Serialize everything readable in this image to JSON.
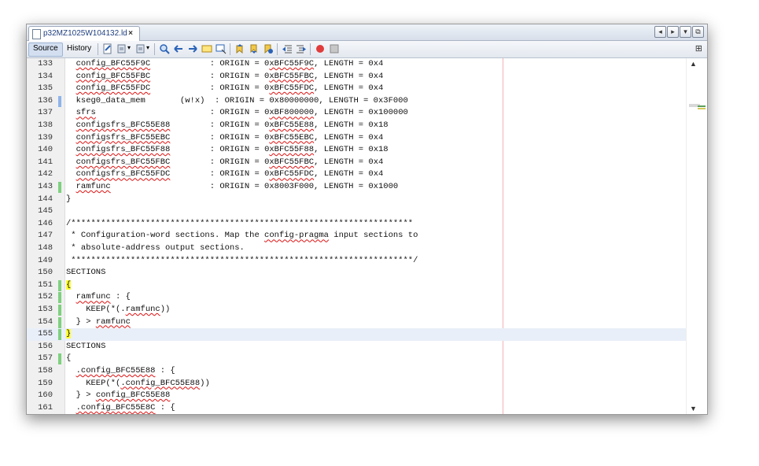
{
  "tab": {
    "title": "p32MZ1025W104132.ld",
    "close": "×"
  },
  "window_controls": [
    "◂",
    "▸",
    "▾",
    "⧉"
  ],
  "toolbar": {
    "source_label": "Source",
    "history_label": "History",
    "icons": [
      "last-edit-icon",
      "back-icon",
      "forward-icon",
      "find-selection-icon",
      "find-previous-icon",
      "find-next-icon",
      "toggle-highlight-icon",
      "toggle-rect-select-icon",
      "previous-bookmark-icon",
      "next-bookmark-icon",
      "toggle-bookmark-icon",
      "shift-left-icon",
      "shift-right-icon",
      "record-macro-icon",
      "stop-macro-icon"
    ],
    "right_icon": "⊞"
  },
  "editor": {
    "lines": [
      {
        "num": "133",
        "mark": "",
        "code": "  config_BFC55F9C            : ORIGIN = 0xBFC55F9C, LENGTH = 0x4"
      },
      {
        "num": "134",
        "mark": "",
        "code": "  config_BFC55FBC            : ORIGIN = 0xBFC55FBC, LENGTH = 0x4"
      },
      {
        "num": "135",
        "mark": "",
        "code": "  config_BFC55FDC            : ORIGIN = 0xBFC55FDC, LENGTH = 0x4"
      },
      {
        "num": "136",
        "mark": "blue",
        "code": "  kseg0_data_mem       (w!x)  : ORIGIN = 0x80000000, LENGTH = 0x3F000"
      },
      {
        "num": "137",
        "mark": "",
        "code": "  sfrs                       : ORIGIN = 0xBF800000, LENGTH = 0x100000"
      },
      {
        "num": "138",
        "mark": "",
        "code": "  configsfrs_BFC55E88        : ORIGIN = 0xBFC55E88, LENGTH = 0x18"
      },
      {
        "num": "139",
        "mark": "",
        "code": "  configsfrs_BFC55EBC        : ORIGIN = 0xBFC55EBC, LENGTH = 0x4"
      },
      {
        "num": "140",
        "mark": "",
        "code": "  configsfrs_BFC55F88        : ORIGIN = 0xBFC55F88, LENGTH = 0x18"
      },
      {
        "num": "141",
        "mark": "",
        "code": "  configsfrs_BFC55FBC        : ORIGIN = 0xBFC55FBC, LENGTH = 0x4"
      },
      {
        "num": "142",
        "mark": "",
        "code": "  configsfrs_BFC55FDC        : ORIGIN = 0xBFC55FDC, LENGTH = 0x4"
      },
      {
        "num": "143",
        "mark": "green",
        "code": "  ramfunc                    : ORIGIN = 0x8003F000, LENGTH = 0x1000"
      },
      {
        "num": "144",
        "mark": "",
        "code": "}"
      },
      {
        "num": "145",
        "mark": "",
        "code": ""
      },
      {
        "num": "146",
        "mark": "",
        "code": "/*********************************************************************"
      },
      {
        "num": "147",
        "mark": "",
        "code": " * Configuration-word sections. Map the config-pragma input sections to"
      },
      {
        "num": "148",
        "mark": "",
        "code": " * absolute-address output sections."
      },
      {
        "num": "149",
        "mark": "",
        "code": " *********************************************************************/"
      },
      {
        "num": "150",
        "mark": "",
        "code": "SECTIONS"
      },
      {
        "num": "151",
        "mark": "green",
        "code": "{"
      },
      {
        "num": "152",
        "mark": "green",
        "code": "  ramfunc : {"
      },
      {
        "num": "153",
        "mark": "green",
        "code": "    KEEP(*(.ramfunc))"
      },
      {
        "num": "154",
        "mark": "green",
        "code": "  } > ramfunc"
      },
      {
        "num": "155",
        "mark": "green",
        "code": "}"
      },
      {
        "num": "156",
        "mark": "",
        "code": "SECTIONS"
      },
      {
        "num": "157",
        "mark": "green",
        "code": "{"
      },
      {
        "num": "158",
        "mark": "",
        "code": "  .config_BFC55E88 : {"
      },
      {
        "num": "159",
        "mark": "",
        "code": "    KEEP(*(.config_BFC55E88))"
      },
      {
        "num": "160",
        "mark": "",
        "code": "  } > config_BFC55E88"
      },
      {
        "num": "161",
        "mark": "",
        "code": "  .config_BFC55E8C : {"
      }
    ],
    "current_line": "155"
  },
  "scrollbar": {
    "up": "▲",
    "down": "▼"
  },
  "colors": {
    "change_green": "#7fd07f",
    "change_blue": "#8fb4ea",
    "margin_line": "#f2b3b3",
    "bracket_highlight": "#ffff33"
  }
}
